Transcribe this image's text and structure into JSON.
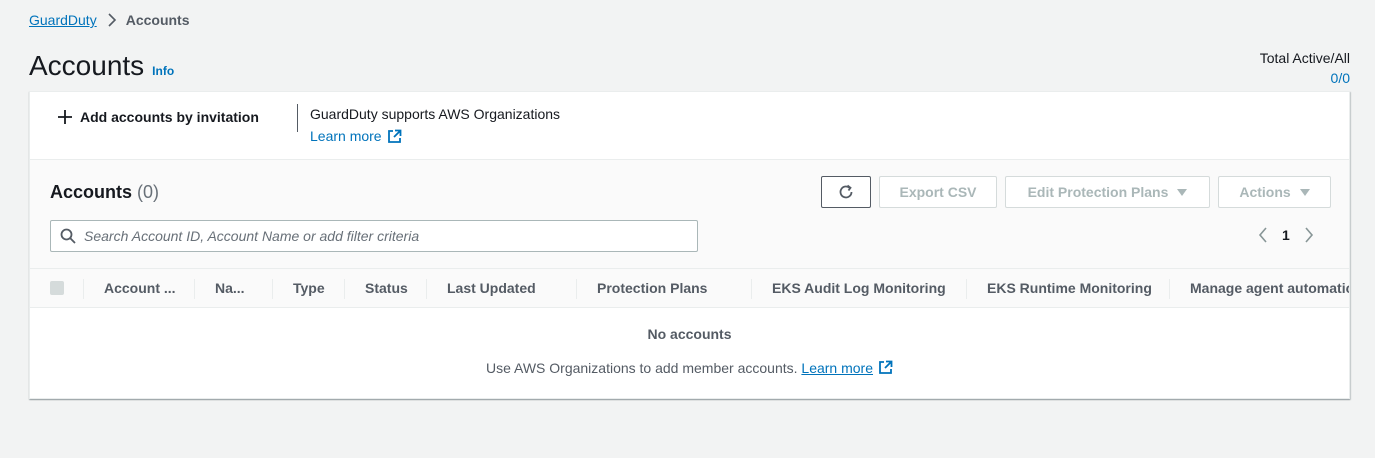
{
  "breadcrumb": {
    "root": "GuardDuty",
    "current": "Accounts"
  },
  "page": {
    "title": "Accounts",
    "info": "Info"
  },
  "total": {
    "label": "Total Active/All",
    "value": "0/0"
  },
  "invite": {
    "add_label": "Add accounts by invitation",
    "org_text": "GuardDuty supports AWS Organizations",
    "learn_more": "Learn more"
  },
  "table": {
    "title": "Accounts",
    "count": "(0)",
    "export_label": "Export CSV",
    "edit_label": "Edit Protection Plans",
    "actions_label": "Actions",
    "search_placeholder": "Search Account ID, Account Name or add filter criteria",
    "page_number": "1",
    "columns": [
      "Account ...",
      "Na...",
      "Type",
      "Status",
      "Last Updated",
      "Protection Plans",
      "EKS Audit Log Monitoring",
      "EKS Runtime Monitoring",
      "Manage agent automatically"
    ],
    "empty_title": "No accounts",
    "empty_desc": "Use AWS Organizations to add member accounts.",
    "empty_link": "Learn more"
  },
  "colors": {
    "link": "#0073bb",
    "text": "#16191f",
    "muted": "#545b64",
    "disabled": "#aab7b8",
    "background": "#f2f3f3"
  },
  "icons": [
    "chevron-right-icon",
    "plus-icon",
    "external-link-icon",
    "refresh-icon",
    "caret-down-icon",
    "search-icon",
    "chevron-left-icon"
  ]
}
